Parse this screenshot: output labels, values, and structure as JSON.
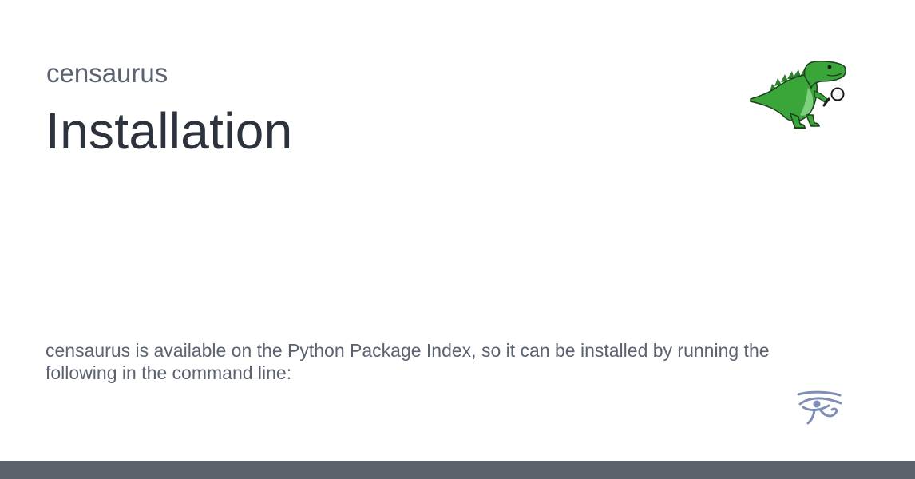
{
  "site": {
    "name": "censaurus"
  },
  "page": {
    "title": "Installation",
    "description": "censaurus is available on the Python Package Index, so it can be installed by running the following in the command line:"
  },
  "icons": {
    "logo": "dinosaur-magnifier-logo",
    "footer_mark": "eye-of-horus-icon"
  },
  "colors": {
    "title": "#2d333d",
    "text": "#5b6270",
    "dino_green": "#3aa63a",
    "eye_mark": "#7f8eb7",
    "footer_bar": "#5c626c"
  }
}
